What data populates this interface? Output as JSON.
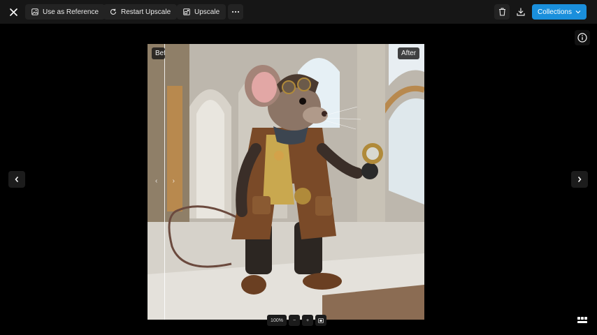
{
  "toolbar": {
    "close_icon": "close-icon",
    "use_as_reference_label": "Use as Reference",
    "restart_upscale_label": "Restart Upscale",
    "upscale_label": "Upscale",
    "more_icon": "more-horizontal-icon",
    "trash_icon": "trash-icon",
    "download_icon": "download-icon",
    "collections_label": "Collections"
  },
  "viewer": {
    "before_label": "Before",
    "after_label": "After",
    "zoom_level": "100%",
    "zoom_out_label": "−",
    "zoom_in_label": "+",
    "image_subject": "steampunk mouse in leather coat holding a compass"
  },
  "colors": {
    "accent": "#1a8fdc",
    "topbar": "#161616",
    "button": "#232323"
  }
}
